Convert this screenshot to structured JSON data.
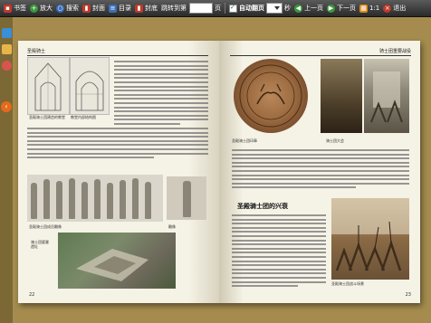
{
  "toolbar": {
    "items": [
      {
        "label": "书签",
        "icon": "bookmark-icon",
        "color": "#c0392b"
      },
      {
        "label": "放大",
        "icon": "zoom-in-icon",
        "color": "#3a9a3a"
      },
      {
        "label": "搜索",
        "icon": "search-icon",
        "color": "#3b6fb8"
      },
      {
        "label": "封面",
        "icon": "cover-icon",
        "color": "#c0392b"
      },
      {
        "label": "目录",
        "icon": "contents-icon",
        "color": "#3b6fb8"
      },
      {
        "label": "封底",
        "icon": "back-cover-icon",
        "color": "#c0392b"
      }
    ],
    "goto_label": "跳转到第",
    "goto_value": "",
    "page_unit": "页",
    "autoflip_label": "自动翻页",
    "seconds_unit": "秒",
    "prev_label": "上一页",
    "next_label": "下一页",
    "ratio_label": "1:1",
    "exit_label": "退出"
  },
  "book": {
    "left_header": "圣殿骑士",
    "right_header": "骑士团重要战役",
    "left_folio": "22",
    "right_folio": "23",
    "section_title": "圣殿骑士团的兴衰",
    "captions": {
      "church_left": "圣殿骑士团建造的教堂",
      "church_right": "教堂内部结构图",
      "statues": "圣殿骑士团成员雕像",
      "small": "雕像",
      "aerial": "骑士团要塞遗址",
      "seal": "圣殿骑士团印章",
      "painting1": "骑士团大会",
      "painting3": "圣殿骑士团战斗场景"
    }
  }
}
